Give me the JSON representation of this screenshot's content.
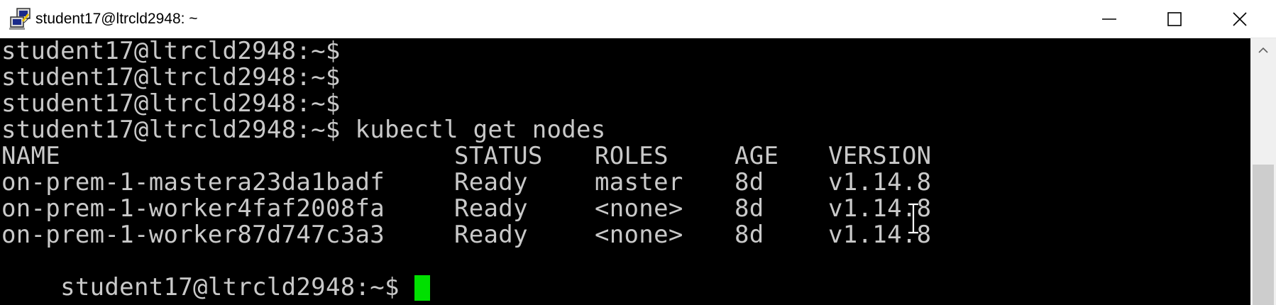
{
  "window": {
    "title": "student17@ltrcld2948: ~",
    "icon": "putty-icon",
    "controls": [
      "minimize-icon",
      "maximize-icon",
      "close-icon"
    ]
  },
  "terminal": {
    "prompts": [
      "student17@ltrcld2948:~$",
      "student17@ltrcld2948:~$",
      "student17@ltrcld2948:~$"
    ],
    "command_line": "student17@ltrcld2948:~$ kubectl get nodes",
    "table": {
      "headers": [
        "NAME",
        "STATUS",
        "ROLES",
        "AGE",
        "VERSION"
      ],
      "rows": [
        [
          "on-prem-1-mastera23da1badf",
          "Ready",
          "master",
          "8d",
          "v1.14.8"
        ],
        [
          "on-prem-1-worker4faf2008fa",
          "Ready",
          "<none>",
          "8d",
          "v1.14.8"
        ],
        [
          "on-prem-1-worker87d747c3a3",
          "Ready",
          "<none>",
          "8d",
          "v1.14.8"
        ]
      ]
    },
    "final_prompt": "student17@ltrcld2948:~$ ",
    "colors": {
      "background": "#000000",
      "text": "#c9c9c9",
      "cursor": "#00e000"
    }
  }
}
